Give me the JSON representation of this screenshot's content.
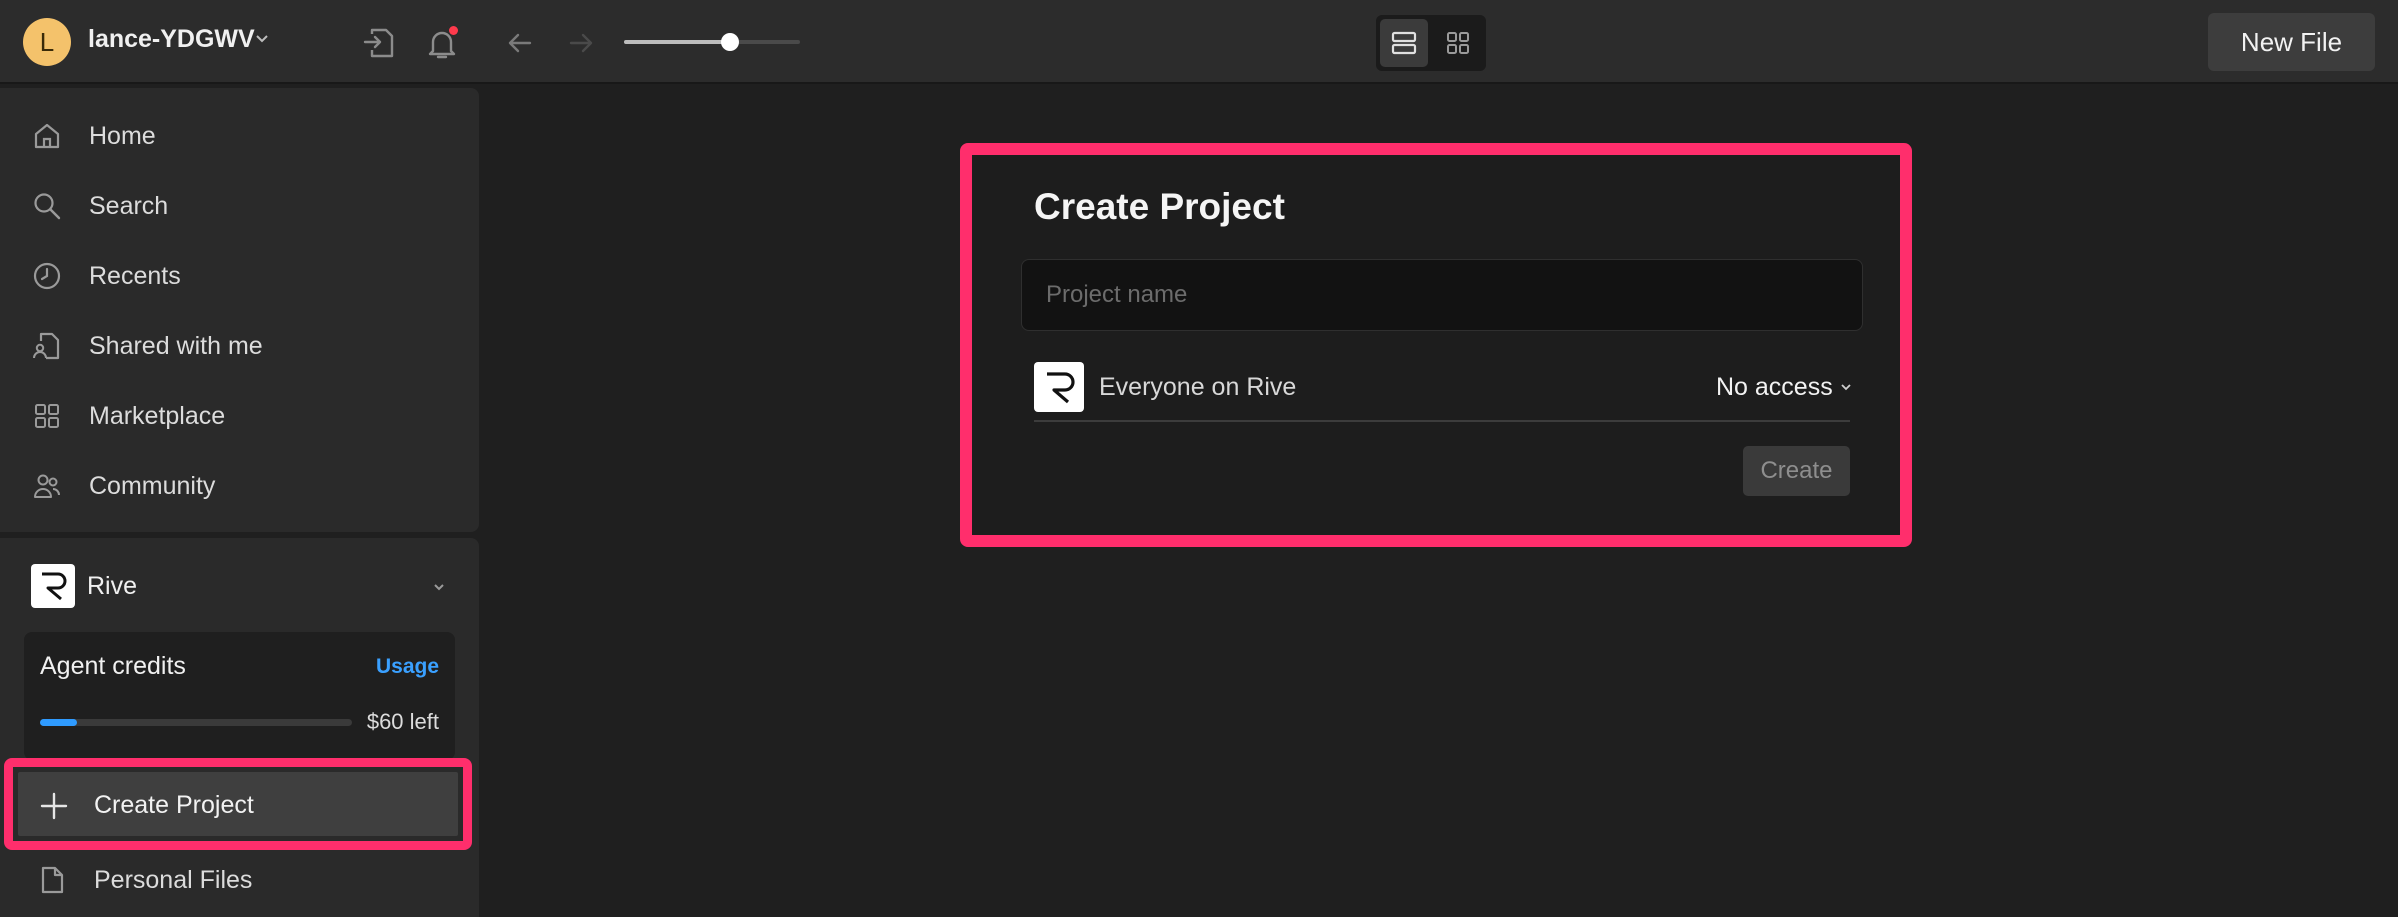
{
  "topbar": {
    "avatar_initial": "L",
    "username": "lance-YDGWV",
    "zoom_level": 0.6,
    "new_file_label": "New File",
    "view_mode": "list"
  },
  "sidebar": {
    "nav_items": [
      {
        "label": "Home",
        "icon": "home-icon"
      },
      {
        "label": "Search",
        "icon": "search-icon"
      },
      {
        "label": "Recents",
        "icon": "clock-icon"
      },
      {
        "label": "Shared with me",
        "icon": "shared-file-icon"
      },
      {
        "label": "Marketplace",
        "icon": "grid-icon"
      },
      {
        "label": "Community",
        "icon": "people-icon"
      }
    ],
    "team": {
      "name": "Rive",
      "credits": {
        "title": "Agent credits",
        "usage_label": "Usage",
        "remaining": "$60 left",
        "used_fraction": 0.12
      }
    },
    "create_project_label": "Create Project",
    "personal_files_label": "Personal Files"
  },
  "dialog": {
    "title": "Create Project",
    "name_placeholder": "Project name",
    "name_value": "",
    "access_label": "Everyone on Rive",
    "access_value": "No access",
    "create_label": "Create"
  },
  "colors": {
    "highlight": "#ff2e6c",
    "accent": "#2f9bff",
    "avatar": "#f4c26b"
  }
}
